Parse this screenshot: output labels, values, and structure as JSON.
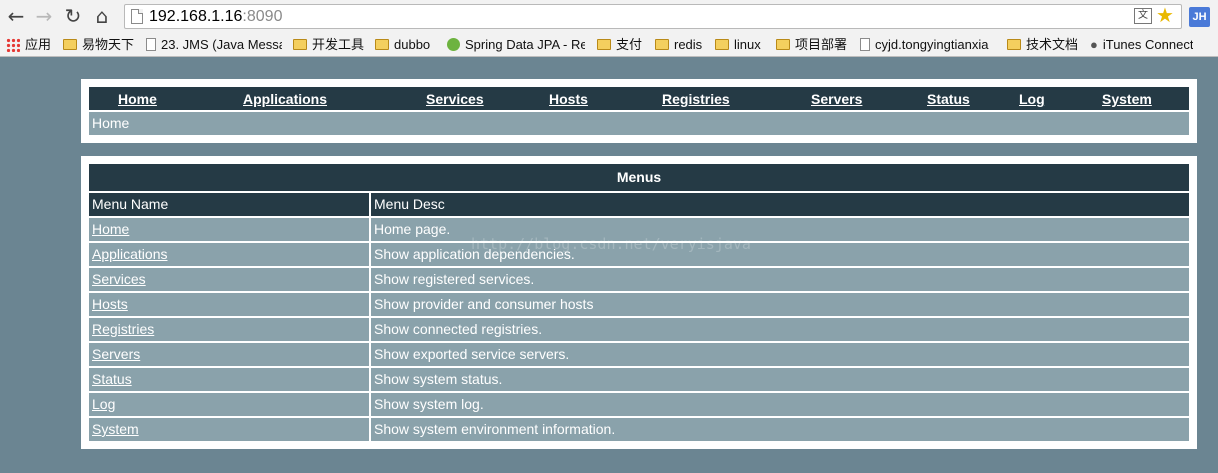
{
  "browser": {
    "url_host": "192.168.1.16",
    "url_port": ":8090",
    "avatar_initials": "JH",
    "bookmarks": [
      {
        "label": "应用",
        "icon": "apps-grid-icon"
      },
      {
        "label": "易物天下",
        "icon": "folder-icon"
      },
      {
        "label": "23. JMS (Java Messa",
        "icon": "page-icon"
      },
      {
        "label": "开发工具",
        "icon": "folder-icon"
      },
      {
        "label": "dubbo",
        "icon": "folder-icon"
      },
      {
        "label": "Spring Data JPA - Re",
        "icon": "spring-icon"
      },
      {
        "label": "支付",
        "icon": "folder-icon"
      },
      {
        "label": "redis",
        "icon": "folder-icon"
      },
      {
        "label": "linux",
        "icon": "folder-icon"
      },
      {
        "label": "项目部署",
        "icon": "folder-icon"
      },
      {
        "label": "cyjd.tongyingtianxia",
        "icon": "page-icon"
      },
      {
        "label": "技术文档",
        "icon": "folder-icon"
      },
      {
        "label": "iTunes Connect",
        "icon": "apple-icon"
      }
    ]
  },
  "nav": {
    "items": [
      "Home",
      "Applications",
      "Services",
      "Hosts",
      "Registries",
      "Servers",
      "Status",
      "Log",
      "System"
    ],
    "breadcrumb": "Home"
  },
  "menus": {
    "title": "Menus",
    "headers": [
      "Menu Name",
      "Menu Desc"
    ],
    "rows": [
      {
        "name": "Home",
        "desc": "Home page."
      },
      {
        "name": "Applications",
        "desc": "Show application dependencies."
      },
      {
        "name": "Services",
        "desc": "Show registered services."
      },
      {
        "name": "Hosts",
        "desc": "Show provider and consumer hosts"
      },
      {
        "name": "Registries",
        "desc": "Show connected registries."
      },
      {
        "name": "Servers",
        "desc": "Show exported service servers."
      },
      {
        "name": "Status",
        "desc": "Show system status."
      },
      {
        "name": "Log",
        "desc": "Show system log."
      },
      {
        "name": "System",
        "desc": "Show system environment information."
      }
    ]
  },
  "watermark": "http://blog.csdn.net/veryisjava",
  "colors": {
    "page_bg": "#6b8592",
    "header_bg": "#253a45",
    "row_bg": "#8aa2ab"
  }
}
